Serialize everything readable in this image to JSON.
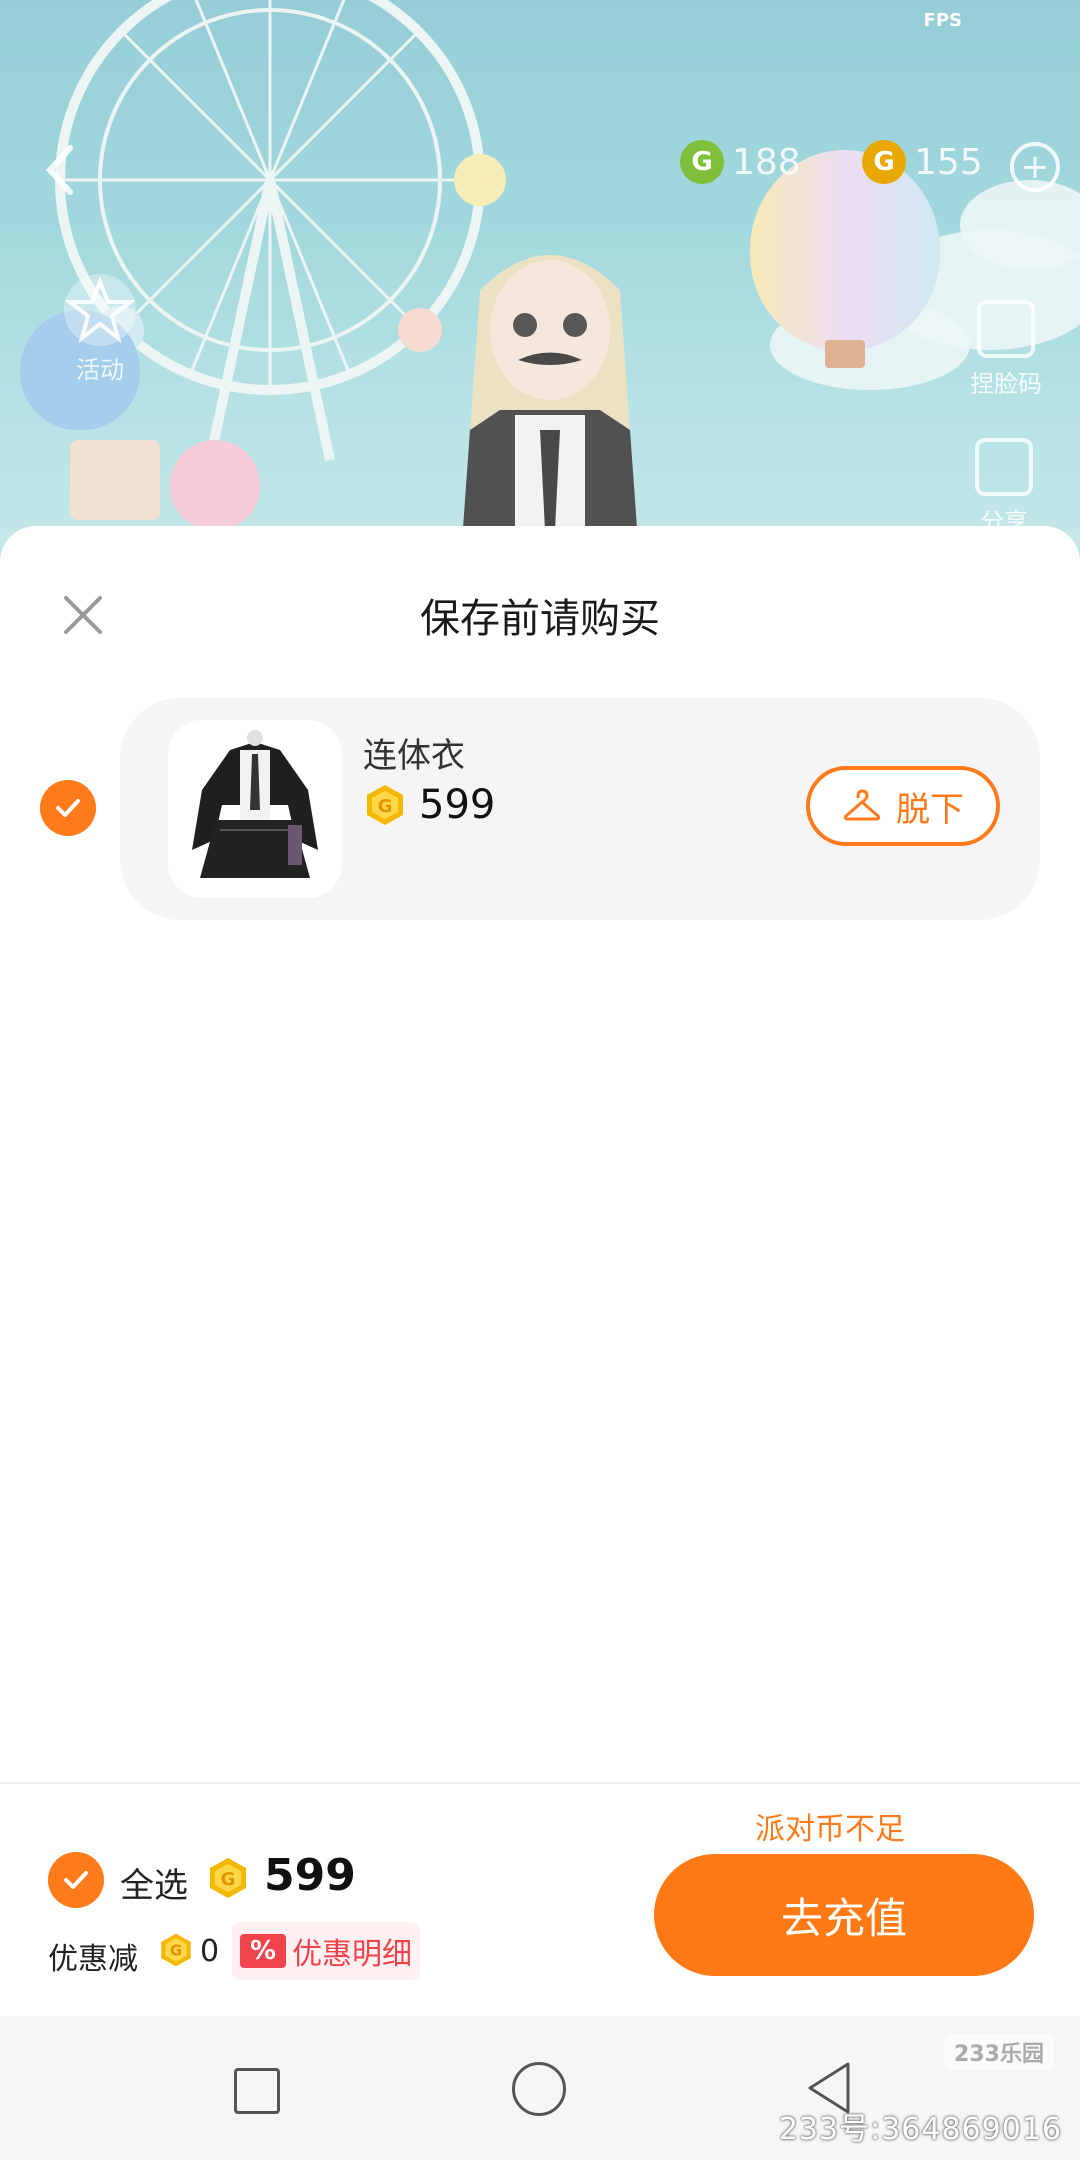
{
  "background": {
    "fps_label": "FPS",
    "currency_1": "188",
    "currency_2": "155",
    "activity_label": "活动",
    "face_label": "捏脸码",
    "share_label": "分享"
  },
  "sheet": {
    "title": "保存前请购买",
    "item": {
      "name": "连体衣",
      "price": "599",
      "takeoff_label": "脱下",
      "selected": true
    }
  },
  "footer": {
    "insufficient_text": "派对币不足",
    "select_all_label": "全选",
    "total_price": "599",
    "discount_label": "优惠减",
    "discount_value": "0",
    "discount_badge": "%",
    "discount_detail_label": "优惠明细",
    "recharge_label": "去充值"
  },
  "watermark": {
    "logo_text": "233乐园",
    "id_text": "233号:364869016"
  },
  "colors": {
    "accent": "#ff7a1a",
    "discount_red": "#f0434c",
    "coin_gold": "#f5b800"
  },
  "icons": {
    "close": "close-icon",
    "check": "check-icon",
    "hanger": "hanger-icon",
    "coin": "coin-icon",
    "back": "back-arrow-icon"
  }
}
